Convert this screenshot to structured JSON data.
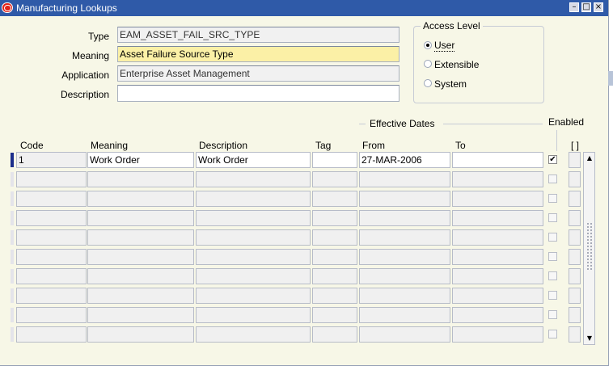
{
  "window": {
    "title": "Manufacturing Lookups",
    "buttons": [
      "minimize",
      "maximize",
      "close"
    ]
  },
  "header": {
    "type_label": "Type",
    "type_value": "EAM_ASSET_FAIL_SRC_TYPE",
    "meaning_label": "Meaning",
    "meaning_value": "Asset Failure Source Type",
    "application_label": "Application",
    "application_value": "Enterprise Asset Management",
    "description_label": "Description",
    "description_value": ""
  },
  "access_level": {
    "title": "Access Level",
    "options": [
      {
        "label": "User",
        "selected": true
      },
      {
        "label": "Extensible",
        "selected": false
      },
      {
        "label": "System",
        "selected": false
      }
    ]
  },
  "table": {
    "effective_dates_label": "Effective Dates",
    "enabled_label": "Enabled",
    "dff_label": "[ ]",
    "columns": {
      "code": "Code",
      "meaning": "Meaning",
      "description": "Description",
      "tag": "Tag",
      "from": "From",
      "to": "To"
    },
    "rows": [
      {
        "code": "1",
        "meaning": "Work Order",
        "description": "Work Order",
        "tag": "",
        "from": "27-MAR-2006",
        "to": "",
        "enabled": true,
        "current": true
      },
      {
        "code": "",
        "meaning": "",
        "description": "",
        "tag": "",
        "from": "",
        "to": "",
        "enabled": false,
        "current": false
      },
      {
        "code": "",
        "meaning": "",
        "description": "",
        "tag": "",
        "from": "",
        "to": "",
        "enabled": false,
        "current": false
      },
      {
        "code": "",
        "meaning": "",
        "description": "",
        "tag": "",
        "from": "",
        "to": "",
        "enabled": false,
        "current": false
      },
      {
        "code": "",
        "meaning": "",
        "description": "",
        "tag": "",
        "from": "",
        "to": "",
        "enabled": false,
        "current": false
      },
      {
        "code": "",
        "meaning": "",
        "description": "",
        "tag": "",
        "from": "",
        "to": "",
        "enabled": false,
        "current": false
      },
      {
        "code": "",
        "meaning": "",
        "description": "",
        "tag": "",
        "from": "",
        "to": "",
        "enabled": false,
        "current": false
      },
      {
        "code": "",
        "meaning": "",
        "description": "",
        "tag": "",
        "from": "",
        "to": "",
        "enabled": false,
        "current": false
      },
      {
        "code": "",
        "meaning": "",
        "description": "",
        "tag": "",
        "from": "",
        "to": "",
        "enabled": false,
        "current": false
      },
      {
        "code": "",
        "meaning": "",
        "description": "",
        "tag": "",
        "from": "",
        "to": "",
        "enabled": false,
        "current": false
      }
    ]
  },
  "colors": {
    "titlebar": "#2f5aa8",
    "background": "#f7f7e7",
    "required_field": "#fbf0a6",
    "current_record": "#1c2e8c"
  }
}
